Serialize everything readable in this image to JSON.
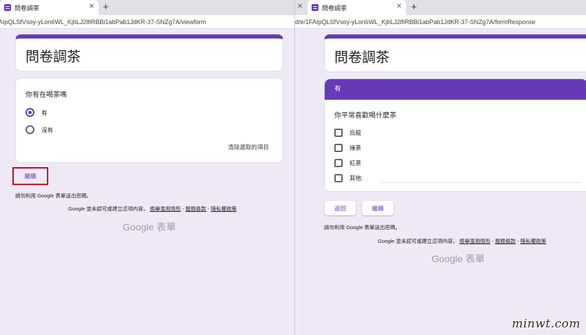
{
  "left": {
    "tab": {
      "title": "問卷調茶"
    },
    "url": "fAIpQLSfVsoy-yLon6WL_KjbLJ2lfiRBBi1abPab1JdKR-37-SNZg7A/viewform",
    "form_title": "問卷調茶",
    "question": {
      "title": "你有在喝茶嗎",
      "options": [
        {
          "label": "有",
          "selected": true
        },
        {
          "label": "沒有",
          "selected": false
        }
      ],
      "clear_label": "清除選取的項目"
    },
    "next_button": "繼續",
    "password_note": "請勿利用 Google 表單送出密碼。",
    "disclaimer": {
      "text": "Google 並未認可或建立這項內容。",
      "links": [
        "檢舉濫用情形",
        "服務條款",
        "隱私權政策"
      ],
      "sep": " - "
    },
    "brand": "Google 表單"
  },
  "right": {
    "tab": {
      "title": "問卷調茶"
    },
    "url": "d/e/1FAIpQLSfVsoy-yLon6WL_KjbLJ2lfiRBBi1abPab1JdKR-37-SNZg7A/formResponse",
    "form_title": "問卷調茶",
    "section_title": "有",
    "question": {
      "title": "你平常喜歡喝什麼茶",
      "options": [
        "烏龍",
        "綠茶",
        "紅茶",
        "其他:"
      ]
    },
    "back_button": "返回",
    "next_button": "繼續",
    "password_note": "請勿利用 Google 表單送出密碼。",
    "disclaimer": {
      "text": "Google 並未認可或建立這項內容。",
      "links": [
        "檢舉濫用情形",
        "服務條款",
        "隱私權政策"
      ],
      "sep": " - "
    },
    "brand": "Google 表單"
  },
  "watermark": "minwt.com",
  "colors": {
    "accent": "#673ab7",
    "background": "#efe9f7",
    "highlight": "#d0021b"
  }
}
